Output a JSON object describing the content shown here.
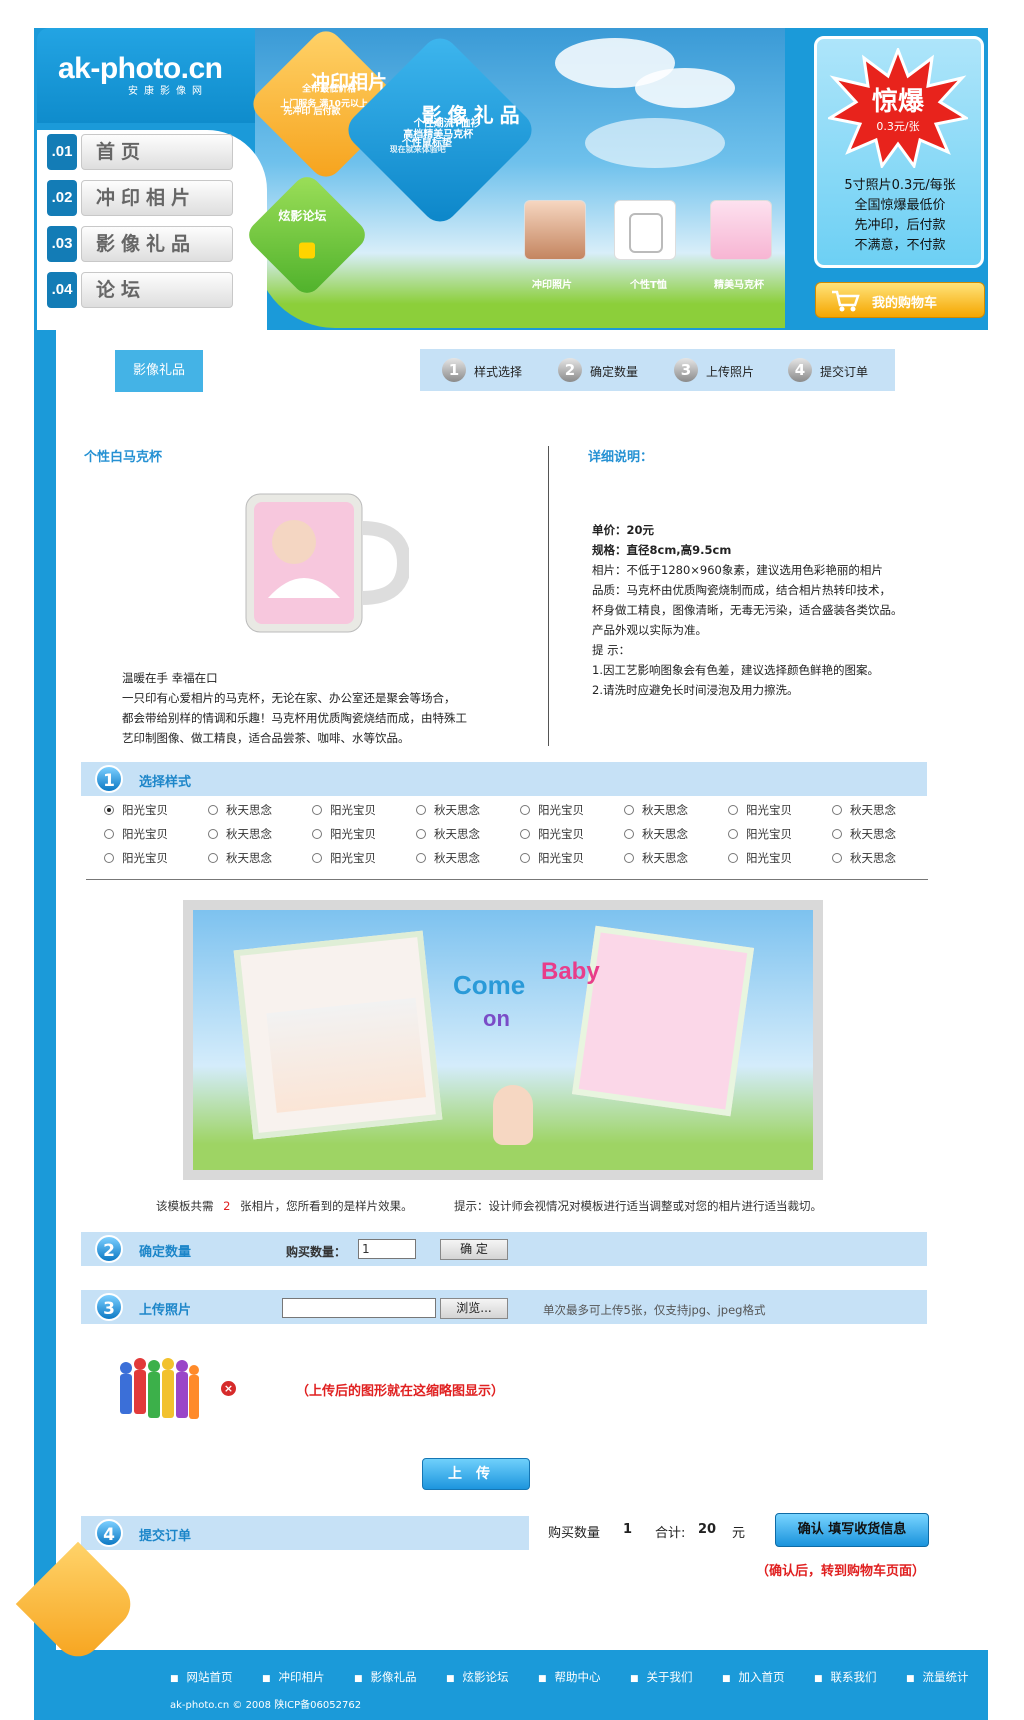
{
  "site": {
    "logo": "ak-photo.cn",
    "logo_sub": "安康影像网"
  },
  "nav": [
    {
      "num": ".01",
      "label": "首页"
    },
    {
      "num": ".02",
      "label": "冲印相片"
    },
    {
      "num": ".03",
      "label": "影像礼品"
    },
    {
      "num": ".04",
      "label": "论坛"
    }
  ],
  "banner": {
    "tile_photo": {
      "title": "冲印相片",
      "lines": [
        "全市最低价格",
        "上门服务 满10元以上",
        "先冲印 后付款"
      ]
    },
    "tile_gift": {
      "title": "影像礼品",
      "lines": [
        "个性潮流T恤衫",
        "高档精美马克杯",
        "个性鼠标垫",
        "现在就来体验吧"
      ]
    },
    "tile_forum": {
      "title": "炫影论坛"
    },
    "products": [
      "冲印照片",
      "个性T恤",
      "精美马克杯"
    ]
  },
  "promo": {
    "burst_title": "惊爆",
    "burst_price": "0.3元/张",
    "lines": [
      "5寸照片0.3元/每张",
      "全国惊爆最低价",
      "先冲印，后付款",
      "不满意，不付款"
    ]
  },
  "cart": {
    "label": "我的购物车"
  },
  "category_tag": "影像礼品",
  "steps": [
    {
      "num": "1",
      "label": "样式选择"
    },
    {
      "num": "2",
      "label": "确定数量"
    },
    {
      "num": "3",
      "label": "上传照片"
    },
    {
      "num": "4",
      "label": "提交订单"
    }
  ],
  "product": {
    "title": "个性白马克杯",
    "desc": [
      "温暖在手 幸福在口",
      "一只印有心爱相片的马克杯，无论在家、办公室还是聚会等场合，",
      "都会带给别样的情调和乐趣！马克杯用优质陶瓷烧结而成，由特殊工",
      "艺印制图像、做工精良，适合品尝茶、咖啡、水等饮品。"
    ]
  },
  "detail": {
    "title": "详细说明：",
    "price_label": "单价：20元",
    "spec_label": "规格：直径8cm,高9.5cm",
    "lines": [
      "相片：不低于1280×960象素，建议选用色彩艳丽的相片",
      "品质：马克杯由优质陶瓷烧制而成，结合相片热转印技术，",
      "杯身做工精良，图像清晰，无毒无污染，适合盛装各类饮品。",
      "产品外观以实际为准。",
      "提  示：",
      "1.因工艺影响图象会有色差，建议选择颜色鲜艳的图案。",
      "2.请洗时应避免长时间浸泡及用力擦洗。"
    ]
  },
  "section1": {
    "num": "1",
    "label": "选择样式"
  },
  "style_options": [
    "阳光宝贝",
    "秋天思念"
  ],
  "template_hint": {
    "pre": "该模板共需",
    "count": "2",
    "post": "张相片，您所看到的是样片效果。",
    "tip": "提示：设计师会视情况对模板进行适当调整或对您的相片进行适当裁切。"
  },
  "template_text": {
    "come": "Come",
    "on": "on",
    "baby": "Baby"
  },
  "section2": {
    "num": "2",
    "label": "确定数量",
    "qty_label": "购买数量：",
    "qty_value": "1",
    "confirm": "确 定"
  },
  "section3": {
    "num": "3",
    "label": "上传照片",
    "browse": "浏览...",
    "note": "单次最多可上传5张，仅支持jpg、jpeg格式"
  },
  "upload": {
    "preview_note": "（上传后的图形就在这缩略图显示）",
    "button": "上传"
  },
  "section4": {
    "num": "4",
    "label": "提交订单"
  },
  "summary": {
    "qty_label": "购买数量",
    "qty": "1",
    "total_label": "合计:",
    "total": "20",
    "unit": "元",
    "confirm": "确认 填写收货信息",
    "note": "（确认后，转到购物车页面）"
  },
  "footer": {
    "links": [
      "网站首页",
      "冲印相片",
      "影像礼品",
      "炫影论坛",
      "帮助中心",
      "关于我们",
      "加入首页",
      "联系我们",
      "流量统计"
    ],
    "copyright": "ak-photo.cn © 2008  陕ICP备06052762"
  },
  "colors": {
    "frame": "#1b9ad9",
    "band": "#c6e1f6",
    "accent": "#2591d3",
    "alert": "#e02020",
    "orange": "#f6a21b"
  }
}
